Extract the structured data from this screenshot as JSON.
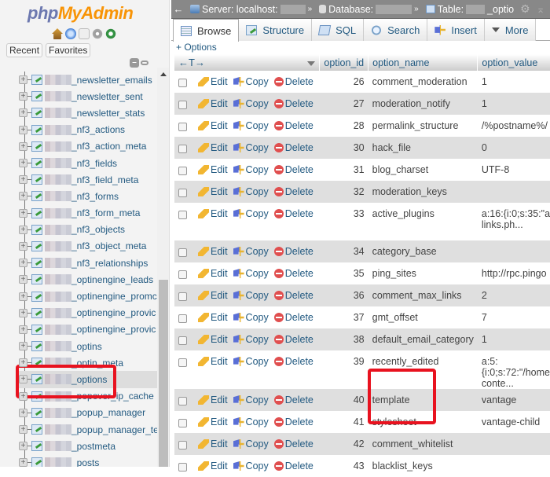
{
  "sidebar": {
    "logo_php": "php",
    "logo_myadmin": "MyAdmin",
    "quick_icons": [
      "home-icon",
      "help-icon",
      "docs-icon",
      "settings-icon",
      "reload-icon"
    ],
    "recent_label": "Recent",
    "favorites_label": "Favorites",
    "tables": [
      {
        "label": "_newsletter_emails"
      },
      {
        "label": "_newsletter_sent"
      },
      {
        "label": "_newsletter_stats"
      },
      {
        "label": "_nf3_actions"
      },
      {
        "label": "_nf3_action_meta"
      },
      {
        "label": "_nf3_fields"
      },
      {
        "label": "_nf3_field_meta"
      },
      {
        "label": "_nf3_forms"
      },
      {
        "label": "_nf3_form_meta"
      },
      {
        "label": "_nf3_objects"
      },
      {
        "label": "_nf3_object_meta"
      },
      {
        "label": "_nf3_relationships"
      },
      {
        "label": "_optinengine_leads"
      },
      {
        "label": "_optinengine_promc"
      },
      {
        "label": "_optinengine_provic"
      },
      {
        "label": "_optinengine_provic"
      },
      {
        "label": "_optins"
      },
      {
        "label": "_optin_meta"
      },
      {
        "label": "_options",
        "selected": true
      },
      {
        "label": "_popover_ip_cache"
      },
      {
        "label": "_popup_manager"
      },
      {
        "label": "_popup_manager_te"
      },
      {
        "label": "_postmeta"
      },
      {
        "label": "_posts"
      }
    ]
  },
  "topbar": {
    "back": "←",
    "server_label": "Server: localhost:",
    "database_label": "Database:",
    "table_label": "Table:",
    "table_suffix": "_optio",
    "separator": "»"
  },
  "tabs": [
    {
      "label": "Browse",
      "icon": "browse-icon",
      "active": true
    },
    {
      "label": "Structure",
      "icon": "structure-icon"
    },
    {
      "label": "SQL",
      "icon": "sql-icon"
    },
    {
      "label": "Search",
      "icon": "search-icon"
    },
    {
      "label": "Insert",
      "icon": "insert-icon"
    },
    {
      "label": "More",
      "icon": "caret-down-icon"
    }
  ],
  "options_link": "+ Options",
  "table": {
    "resize_arrows": "←T→",
    "columns": [
      "option_id",
      "option_name",
      "option_value"
    ],
    "actions": {
      "edit": "Edit",
      "copy": "Copy",
      "delete": "Delete"
    },
    "rows": [
      {
        "id": "26",
        "name": "comment_moderation",
        "value": "1"
      },
      {
        "id": "27",
        "name": "moderation_notify",
        "value": "1"
      },
      {
        "id": "28",
        "name": "permalink_structure",
        "value": "/%postname%/"
      },
      {
        "id": "30",
        "name": "hack_file",
        "value": "0"
      },
      {
        "id": "31",
        "name": "blog_charset",
        "value": "UTF-8"
      },
      {
        "id": "32",
        "name": "moderation_keys",
        "value": ""
      },
      {
        "id": "33",
        "name": "active_plugins",
        "value": "a:16:{i:0;s:35:\"a links.ph...",
        "tall": true
      },
      {
        "id": "34",
        "name": "category_base",
        "value": ""
      },
      {
        "id": "35",
        "name": "ping_sites",
        "value": "http://rpc.pingo"
      },
      {
        "id": "36",
        "name": "comment_max_links",
        "value": "2"
      },
      {
        "id": "37",
        "name": "gmt_offset",
        "value": "7"
      },
      {
        "id": "38",
        "name": "default_email_category",
        "value": "1"
      },
      {
        "id": "39",
        "name": "recently_edited",
        "value": "a:5: {i:0;s:72:\"/home conte...",
        "tall": true
      },
      {
        "id": "40",
        "name": "template",
        "value": "vantage"
      },
      {
        "id": "41",
        "name": "stylesheet",
        "value": "vantage-child"
      },
      {
        "id": "42",
        "name": "comment_whitelist",
        "value": ""
      },
      {
        "id": "43",
        "name": "blacklist_keys",
        "value": ""
      }
    ]
  },
  "highlight_color": "#e8121f"
}
